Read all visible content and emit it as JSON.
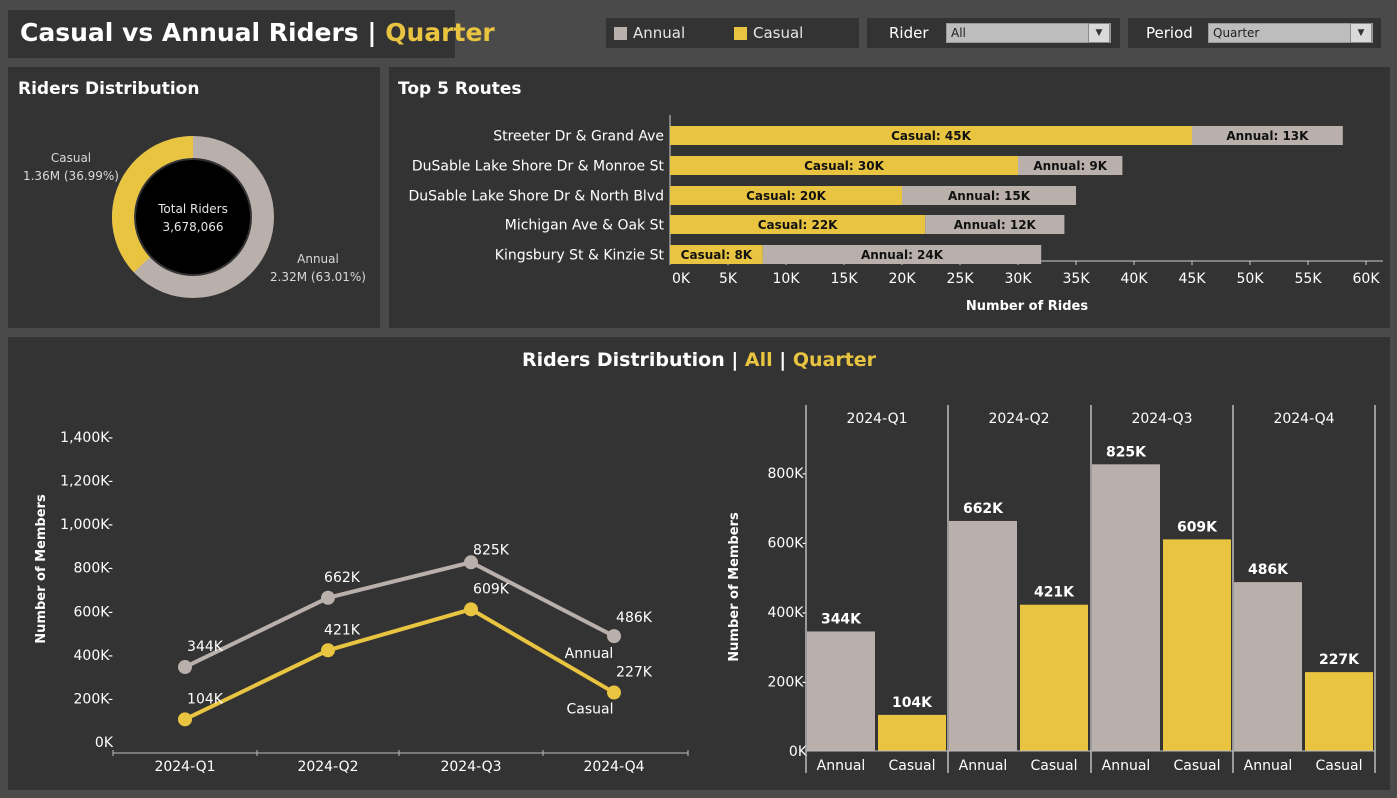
{
  "header": {
    "title_main": "Casual vs Annual Riders |",
    "title_period": "Quarter"
  },
  "legend": {
    "annual_label": "Annual",
    "casual_label": "Casual",
    "annual_color": "#bab0ab",
    "casual_color": "#e9c440"
  },
  "filters": {
    "rider_label": "Rider",
    "rider_value": "All",
    "period_label": "Period",
    "period_value": "Quarter",
    "dropdown_icon": "chevron-down-icon"
  },
  "donut": {
    "panel_title": "Riders Distribution",
    "center_label": "Total Riders",
    "center_value": "3,678,066",
    "casual_name": "Casual",
    "casual_text": "1.36M (36.99%)",
    "annual_name": "Annual",
    "annual_text": "2.32M (63.01%)"
  },
  "routes": {
    "panel_title": "Top 5 Routes",
    "xlabel": "Number of Rides",
    "ticks": [
      "0K",
      "5K",
      "10K",
      "15K",
      "20K",
      "25K",
      "30K",
      "35K",
      "40K",
      "45K",
      "50K",
      "55K",
      "60K"
    ]
  },
  "trend": {
    "title_main": "Riders Distribution |",
    "title_rider": "All",
    "title_sep": "|",
    "title_period": "Quarter",
    "ylabel": "Number of Members",
    "yticks": [
      "0K",
      "200K-",
      "400K-",
      "600K-",
      "800K-",
      "1,000K-",
      "1,200K-",
      "1,400K-"
    ],
    "xticks": [
      "2024-Q1",
      "2024-Q2",
      "2024-Q3",
      "2024-Q4"
    ],
    "annual_end_label": "Annual",
    "casual_end_label": "Casual",
    "annual_value_labels": [
      "344K",
      "662K",
      "825K",
      "486K"
    ],
    "casual_value_labels": [
      "104K",
      "421K",
      "609K",
      "227K"
    ]
  },
  "bars": {
    "ylabel": "Number of Members",
    "yticks": [
      "0K",
      "200K-",
      "400K-",
      "600K-",
      "800K-"
    ],
    "quarters": [
      "2024-Q1",
      "2024-Q2",
      "2024-Q3",
      "2024-Q4"
    ],
    "annual_label": "Annual",
    "casual_label": "Casual",
    "annual_value_labels": [
      "344K",
      "662K",
      "825K",
      "486K"
    ],
    "casual_value_labels": [
      "104K",
      "421K",
      "609K",
      "227K"
    ]
  },
  "chart_data": [
    {
      "type": "pie",
      "title": "Riders Distribution",
      "categories": [
        "Casual",
        "Annual"
      ],
      "values": [
        1.36,
        2.32
      ],
      "percent": [
        36.99,
        63.01
      ],
      "total": 3678066
    },
    {
      "type": "bar",
      "title": "Top 5 Routes",
      "orientation": "horizontal",
      "stacked": true,
      "categories": [
        "Streeter Dr & Grand Ave",
        "DuSable Lake Shore Dr & Monroe St",
        "DuSable Lake Shore Dr & North Blvd",
        "Michigan Ave & Oak St",
        "Kingsbury St & Kinzie St"
      ],
      "series": [
        {
          "name": "Casual",
          "values": [
            45,
            30,
            20,
            22,
            8
          ],
          "labels": [
            "Casual:  45K",
            "Casual:  30K",
            "Casual:  20K",
            "Casual:  22K",
            "Casual:  8K"
          ]
        },
        {
          "name": "Annual",
          "values": [
            13,
            9,
            15,
            12,
            24
          ],
          "labels": [
            "Annual:  13K",
            "Annual:  9K",
            "Annual:  15K",
            "Annual:  12K",
            "Annual:  24K"
          ]
        }
      ],
      "xlabel": "Number of Rides",
      "xlim": [
        0,
        60
      ]
    },
    {
      "type": "line",
      "title": "Riders Distribution | All | Quarter",
      "x": [
        "2024-Q1",
        "2024-Q2",
        "2024-Q3",
        "2024-Q4"
      ],
      "series": [
        {
          "name": "Annual",
          "values": [
            344,
            662,
            825,
            486
          ]
        },
        {
          "name": "Casual",
          "values": [
            104,
            421,
            609,
            227
          ]
        }
      ],
      "ylabel": "Number of Members",
      "ylim": [
        0,
        1400
      ]
    },
    {
      "type": "bar",
      "x": [
        "2024-Q1",
        "2024-Q2",
        "2024-Q3",
        "2024-Q4"
      ],
      "series": [
        {
          "name": "Annual",
          "values": [
            344,
            662,
            825,
            486
          ]
        },
        {
          "name": "Casual",
          "values": [
            104,
            421,
            609,
            227
          ]
        }
      ],
      "ylabel": "Number of Members",
      "ylim": [
        0,
        800
      ]
    }
  ]
}
